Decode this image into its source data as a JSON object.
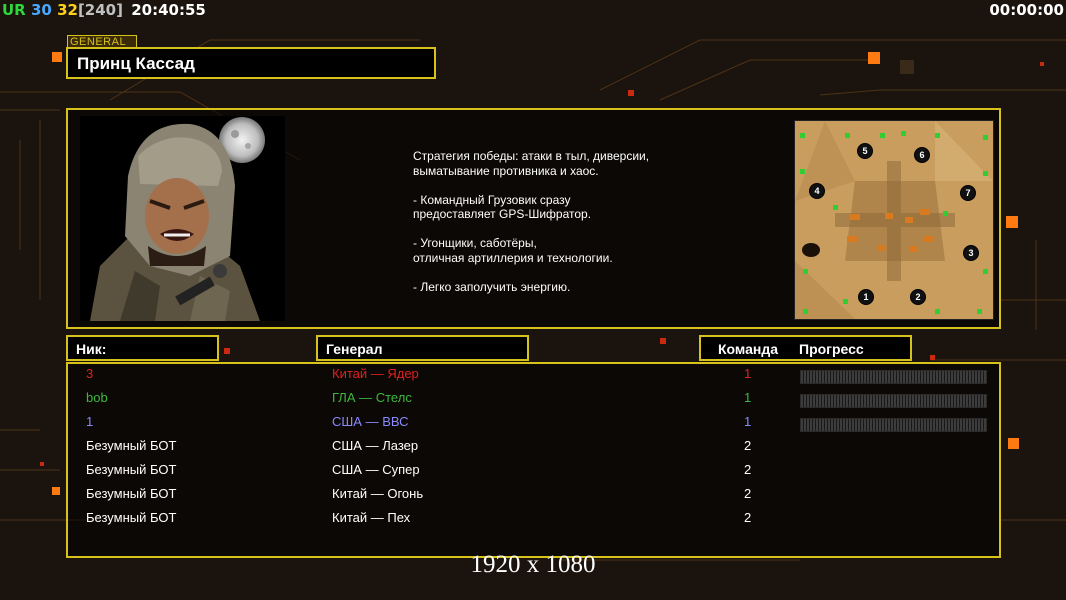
{
  "hud": {
    "gpu_label": "UR",
    "fps_a": "30",
    "fps_b": "32",
    "fps_cap": "[240]",
    "clock": "20:40:55",
    "timer": "00:00:00"
  },
  "general": {
    "tag": "GENERAL",
    "name": "Принц Кассад",
    "description": "Стратегия победы: атаки в тыл, диверсии,\n выматывание противника и хаос.\n\n- Командный Грузовик сразу\nпредоставляет GPS-Шифратор.\n\n- Угонщики, саботёры,\nотличная артиллерия и технологии.\n\n- Легко заполучить энергию.",
    "portrait": "general-portrait-image"
  },
  "map": {
    "spots": [
      "5",
      "6",
      "4",
      "7",
      "3",
      "1",
      "2"
    ]
  },
  "headers": {
    "nick": "Ник:",
    "general": "Генерал",
    "team": "Команда",
    "progress": "Прогресс"
  },
  "players": [
    {
      "nick": "3",
      "general": "Китай — Ядер",
      "team": "1",
      "color": "#e02020",
      "show_progress": true
    },
    {
      "nick": "bob",
      "general": "ГЛА — Стелс",
      "team": "1",
      "color": "#3cb83c",
      "show_progress": true
    },
    {
      "nick": "1",
      "general": "США — ВВС",
      "team": "1",
      "color": "#8a8aff",
      "show_progress": true
    },
    {
      "nick": "Безумный БОТ",
      "general": "США — Лазер",
      "team": "2",
      "color": "#ffffff",
      "show_progress": false
    },
    {
      "nick": "Безумный БОТ",
      "general": "США — Супер",
      "team": "2",
      "color": "#ffffff",
      "show_progress": false
    },
    {
      "nick": "Безумный БОТ",
      "general": "Китай — Огонь",
      "team": "2",
      "color": "#ffffff",
      "show_progress": false
    },
    {
      "nick": "Безумный БОТ",
      "general": "Китай — Пех",
      "team": "2",
      "color": "#ffffff",
      "show_progress": false
    }
  ],
  "resolution": "1920 x 1080",
  "colors": {
    "accent": "#d6c21a",
    "background": "#1a120c",
    "decor_orange": "#ff7a10"
  }
}
